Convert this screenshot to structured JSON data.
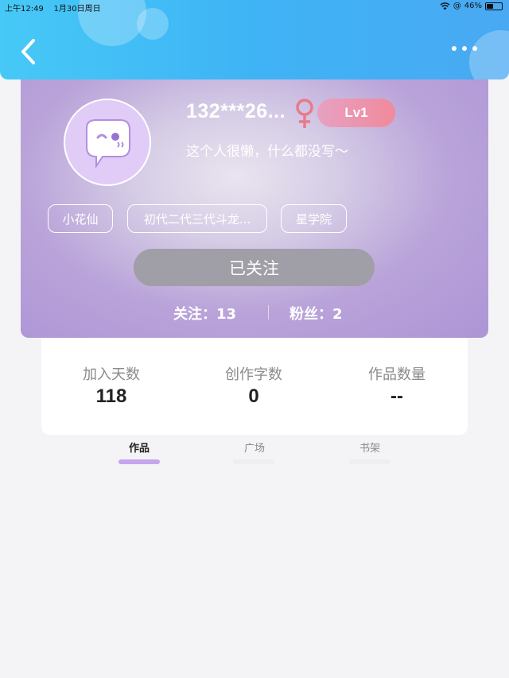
{
  "status_bar": {
    "time": "上午12:49",
    "date": "1月30日周日",
    "battery": "46%",
    "battery_level": 0.46
  },
  "profile": {
    "username": "132***26...",
    "level": "Lv1",
    "bio": "这个人很懒，什么都没写～",
    "tags": [
      "小花仙",
      "初代二代三代斗龙...",
      "星学院"
    ],
    "follow_button": "已关注",
    "following": "关注：13",
    "followers": "粉丝：2"
  },
  "stats": [
    {
      "label": "加入天数",
      "value": "118"
    },
    {
      "label": "创作字数",
      "value": "0"
    },
    {
      "label": "作品数量",
      "value": "--"
    }
  ],
  "tabs": [
    {
      "label": "作品",
      "active": true
    },
    {
      "label": "广场",
      "active": false
    },
    {
      "label": "书架",
      "active": false
    }
  ],
  "colors": {
    "header": "#3fb3f5",
    "card_purple": "#ad95d6",
    "level_badge": "#f08a9b",
    "gender": "#e97a8c",
    "tab_indicator": "#c5a6ec"
  },
  "icons": {
    "back": "back-chevron-icon",
    "more": "more-dots-icon",
    "avatar": "chat-bubble-face-icon",
    "gender": "female-symbol-icon"
  }
}
